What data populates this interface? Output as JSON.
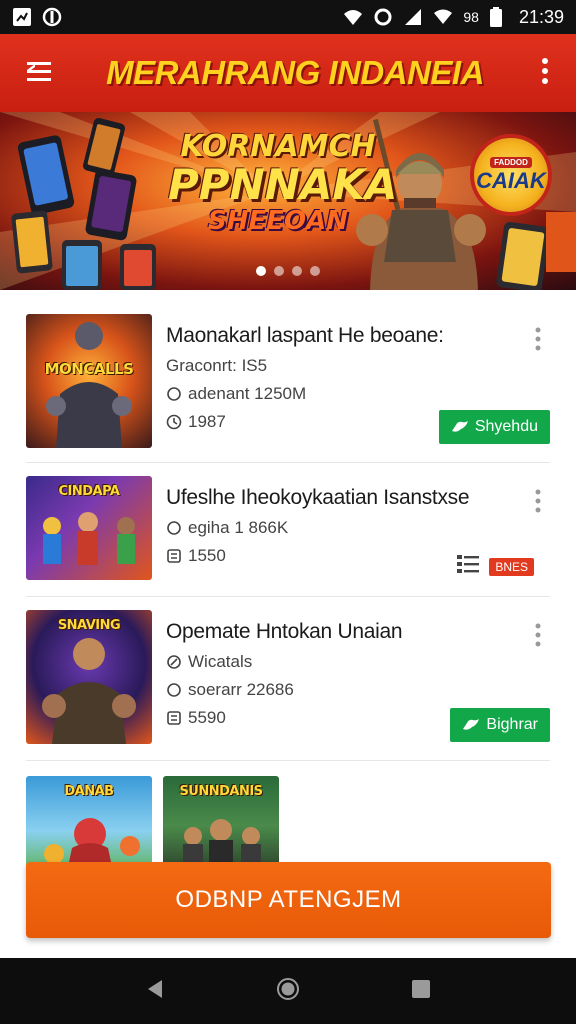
{
  "status_bar": {
    "time": "21:39",
    "battery_text": "98"
  },
  "app_bar": {
    "title": "MERAHRANG INDANEIA"
  },
  "banner": {
    "title_line1": "KORNAMCH",
    "title_line2": "PPNNAKA",
    "title_line3": "SHEEOAN",
    "badge_top": "FADDOD",
    "badge_main": "CAIAK",
    "slides_count": 4,
    "active_slide": 1
  },
  "list": {
    "items": [
      {
        "title": "Maonakarl laspant He beoane:",
        "thumb_text": "MONCALLS",
        "meta1": "Graconrt: IS5",
        "meta2": "adenant 1250M",
        "meta3": "1987",
        "action_label": "Shyehdu"
      },
      {
        "title": "Ufeslhe Iheokoykaatian Isanstxse",
        "thumb_text": "CINDAPA",
        "meta1": "egiha 1 866K",
        "meta2": "1550",
        "tag_label": "BNES"
      },
      {
        "title": "Opemate Hntokan Unaian",
        "thumb_text": "SNAVING",
        "meta1": "Wicatals",
        "meta2": "soerarr 22686",
        "meta3": "5590",
        "action_label": "Bighrar"
      }
    ],
    "row_thumbs": [
      {
        "thumb_text": "DANAB"
      },
      {
        "thumb_text": "SUNNDANIS"
      }
    ]
  },
  "cta": {
    "label": "ODBNP ATENGJEM"
  }
}
